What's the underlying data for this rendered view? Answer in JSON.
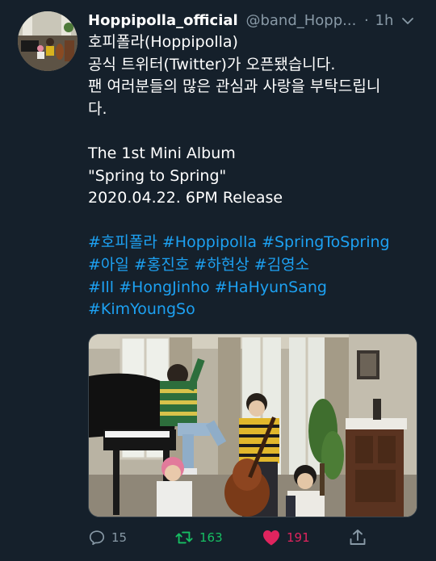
{
  "tweet": {
    "display_name": "Hoppipolla_official",
    "handle": "@band_Hopp...",
    "separator": "·",
    "time": "1h",
    "menu_icon": "chevron-down-icon",
    "lines": [
      "호피폴라(Hoppipolla)",
      "공식 트위터(Twitter)가 오픈됐습니다.",
      "팬 여러분들의 많은 관심과 사랑을 부탁드립니",
      "다.",
      "",
      "The 1st Mini Album",
      "\"Spring to Spring\"",
      "2020.04.22. 6PM Release"
    ],
    "hashtag_lines": [
      [
        "#호피폴라",
        "#Hoppipolla",
        "#SpringToSpring"
      ],
      [
        "#아일",
        "#홍진호",
        "#하현상",
        "#김영소"
      ],
      [
        "#Ill",
        "#HongJinho",
        "#HaHyunSang"
      ],
      [
        "#KimYoungSo"
      ]
    ]
  },
  "actions": {
    "reply_count": "15",
    "retweet_count": "163",
    "like_count": "191",
    "reply_icon": "reply-icon",
    "retweet_icon": "retweet-icon",
    "like_icon": "heart-icon",
    "share_icon": "share-icon"
  },
  "colors": {
    "background": "#15202b",
    "text": "#ffffff",
    "muted": "#8899a6",
    "link": "#1da1f2",
    "retweet": "#17bf63",
    "like": "#e0245e"
  }
}
